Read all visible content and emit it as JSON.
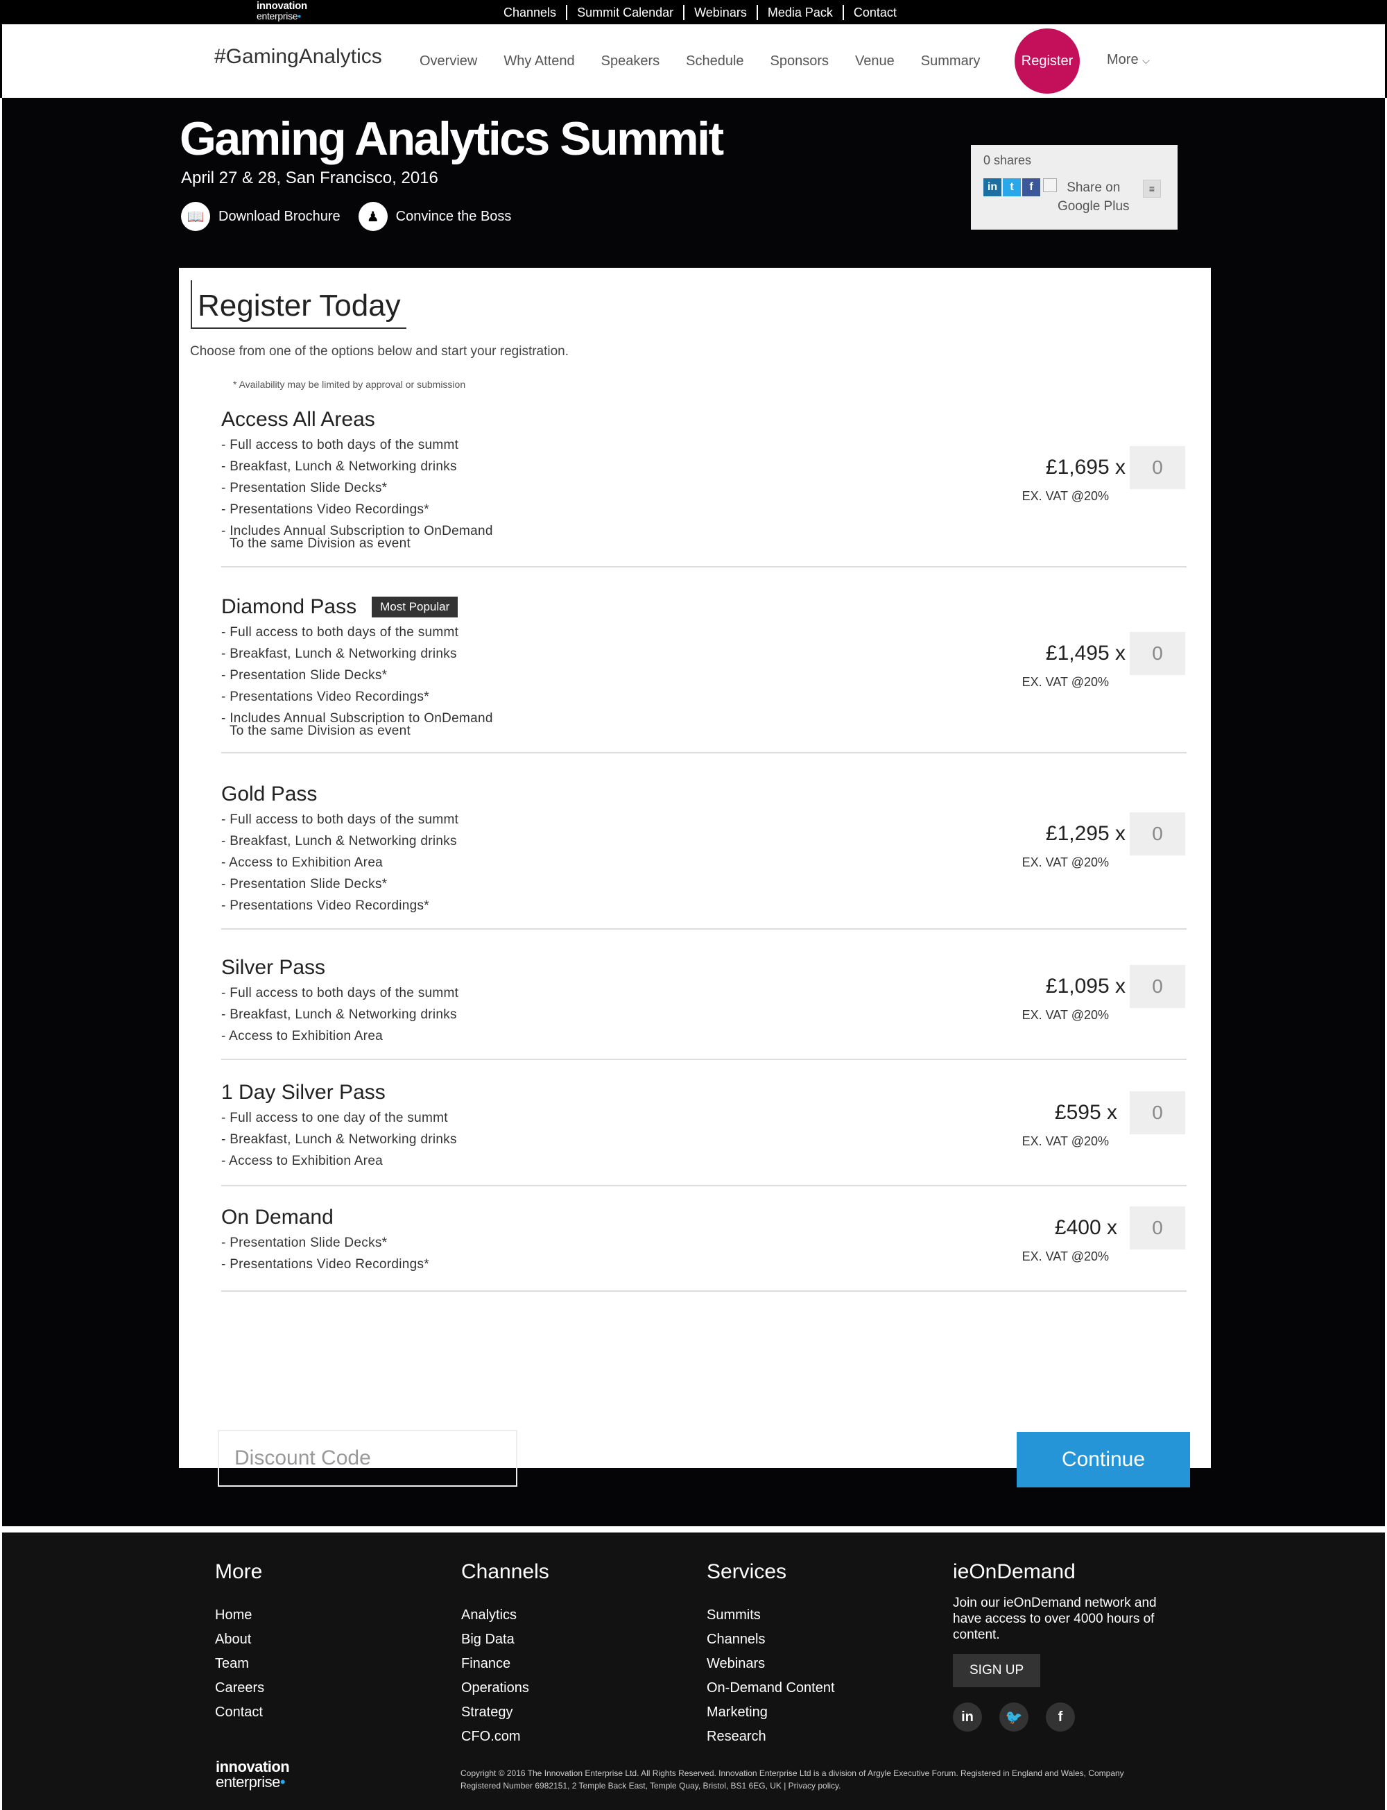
{
  "topbar": {
    "logo_line1": "innovation",
    "logo_line2": "enterprise",
    "links": [
      "Channels",
      "Summit Calendar",
      "Webinars",
      "Media Pack",
      "Contact"
    ]
  },
  "nav": {
    "hashtag": "#GamingAnalytics",
    "links": [
      "Overview",
      "Why Attend",
      "Speakers",
      "Schedule",
      "Sponsors",
      "Venue",
      "Summary"
    ],
    "register": "Register",
    "more": "More"
  },
  "hero": {
    "title": "Gaming Analytics Summit",
    "subtitle": "April 27 & 28, San Francisco, 2016",
    "download": "Download Brochure",
    "convince": "Convince the Boss"
  },
  "share": {
    "count": "0 shares",
    "gplus_line1": "Share on",
    "gplus_line2": "Google Plus"
  },
  "register": {
    "title": "Register Today",
    "intro": "Choose from one of the options below and start your registration.",
    "note": "* Availability may be limited by approval or submission",
    "vat": "EX. VAT @20%",
    "tickets": [
      {
        "name": "Access All Areas",
        "price": "£1,695",
        "qty": "0",
        "features": [
          "- Full access to both days of the summt",
          "- Breakfast, Lunch & Networking drinks",
          "- Presentation Slide Decks*",
          "- Presentations Video Recordings*",
          "- Includes Annual Subscription to OnDemand"
        ],
        "continuation": "To the same Division as event"
      },
      {
        "name": "Diamond Pass",
        "badge": "Most Popular",
        "price": "£1,495",
        "qty": "0",
        "features": [
          "- Full access to both days of the summt",
          "- Breakfast, Lunch & Networking drinks",
          "- Presentation Slide Decks*",
          "- Presentations Video Recordings*",
          "- Includes Annual Subscription to OnDemand"
        ],
        "continuation": "To the same Division as event"
      },
      {
        "name": "Gold Pass",
        "price": "£1,295",
        "qty": "0",
        "features": [
          "- Full access to both days of the summt",
          "- Breakfast, Lunch & Networking drinks",
          "- Access to Exhibition Area",
          "- Presentation Slide Decks*",
          "- Presentations Video Recordings*"
        ]
      },
      {
        "name": "Silver Pass",
        "price": "£1,095",
        "qty": "0",
        "features": [
          "- Full access to both days of the summt",
          "- Breakfast, Lunch & Networking drinks",
          "- Access to Exhibition Area"
        ]
      },
      {
        "name": "1 Day Silver Pass",
        "price": "£595",
        "qty": "0",
        "features": [
          "- Full access to one day of the summt",
          "- Breakfast, Lunch & Networking drinks",
          "- Access to Exhibition Area"
        ]
      },
      {
        "name": "On Demand",
        "price": "£400",
        "qty": "0",
        "features": [
          "- Presentation Slide Decks*",
          "- Presentations Video Recordings*"
        ]
      }
    ],
    "discount_placeholder": "Discount Code",
    "continue": "Continue"
  },
  "footer": {
    "more": {
      "title": "More",
      "links": [
        "Home",
        "About",
        "Team",
        "Careers",
        "Contact"
      ]
    },
    "channels": {
      "title": "Channels",
      "links": [
        "Analytics",
        "Big Data",
        "Finance",
        "Operations",
        "Strategy",
        "CFO.com"
      ]
    },
    "services": {
      "title": "Services",
      "links": [
        "Summits",
        "Channels",
        "Webinars",
        "On-Demand Content",
        "Marketing",
        "Research"
      ]
    },
    "ondemand": {
      "title": "ieOnDemand",
      "text": "Join our ieOnDemand network and have access to over 4000 hours of content.",
      "signup": "SIGN UP"
    },
    "logo_line1": "innovation",
    "logo_line2": "enterprise",
    "copyright": "Copyright © 2016 The Innovation Enterprise Ltd. All Rights Reserved. Innovation Enterprise Ltd is a division of Argyle Executive Forum. Registered in England and Wales, Company Registered Number 6982151, 2 Temple Back East, Temple Quay, Bristol, BS1 6EG, UK | Privacy policy."
  },
  "colors": {
    "register_accent": "#c4105a",
    "continue_button": "#2595d8",
    "badge_bg": "#333333",
    "hero_bg": "#050507"
  }
}
